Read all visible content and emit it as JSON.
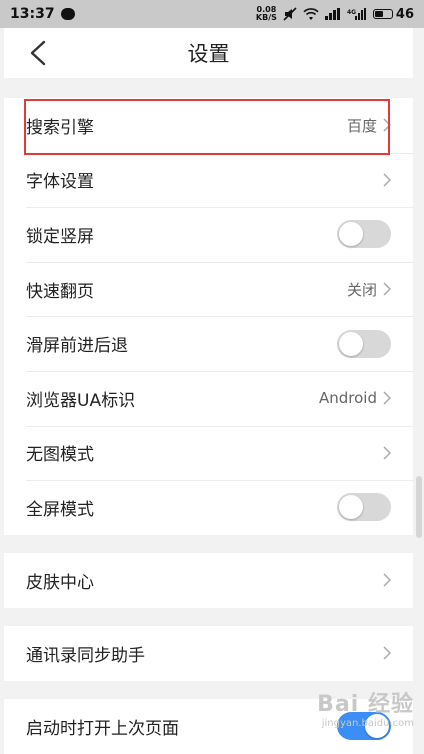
{
  "status_bar": {
    "time": "13:37",
    "net_speed_value": "0.08",
    "net_speed_unit": "KB/S",
    "battery": "46"
  },
  "header": {
    "title": "设置"
  },
  "groups": [
    {
      "rows": [
        {
          "label": "搜索引擎",
          "value": "百度",
          "kind": "link"
        },
        {
          "label": "字体设置",
          "value": "",
          "kind": "link"
        },
        {
          "label": "锁定竖屏",
          "kind": "toggle",
          "on": false
        },
        {
          "label": "快速翻页",
          "value": "关闭",
          "kind": "link"
        },
        {
          "label": "滑屏前进后退",
          "kind": "toggle",
          "on": false
        },
        {
          "label": "浏览器UA标识",
          "value": "Android",
          "kind": "link"
        },
        {
          "label": "无图模式",
          "value": "",
          "kind": "link"
        },
        {
          "label": "全屏模式",
          "kind": "toggle",
          "on": false
        }
      ]
    },
    {
      "rows": [
        {
          "label": "皮肤中心",
          "value": "",
          "kind": "link"
        }
      ]
    },
    {
      "rows": [
        {
          "label": "通讯录同步助手",
          "value": "",
          "kind": "link"
        }
      ]
    },
    {
      "rows": [
        {
          "label": "启动时打开上次页面",
          "kind": "toggle",
          "on": true
        }
      ]
    }
  ],
  "watermark": {
    "brand": "Bai 经验",
    "url": "jingyan.baidu.com"
  },
  "colors": {
    "highlight": "#e03a3a",
    "toggle_on": "#3a8ef6",
    "toggle_off": "#d8d8d8"
  }
}
